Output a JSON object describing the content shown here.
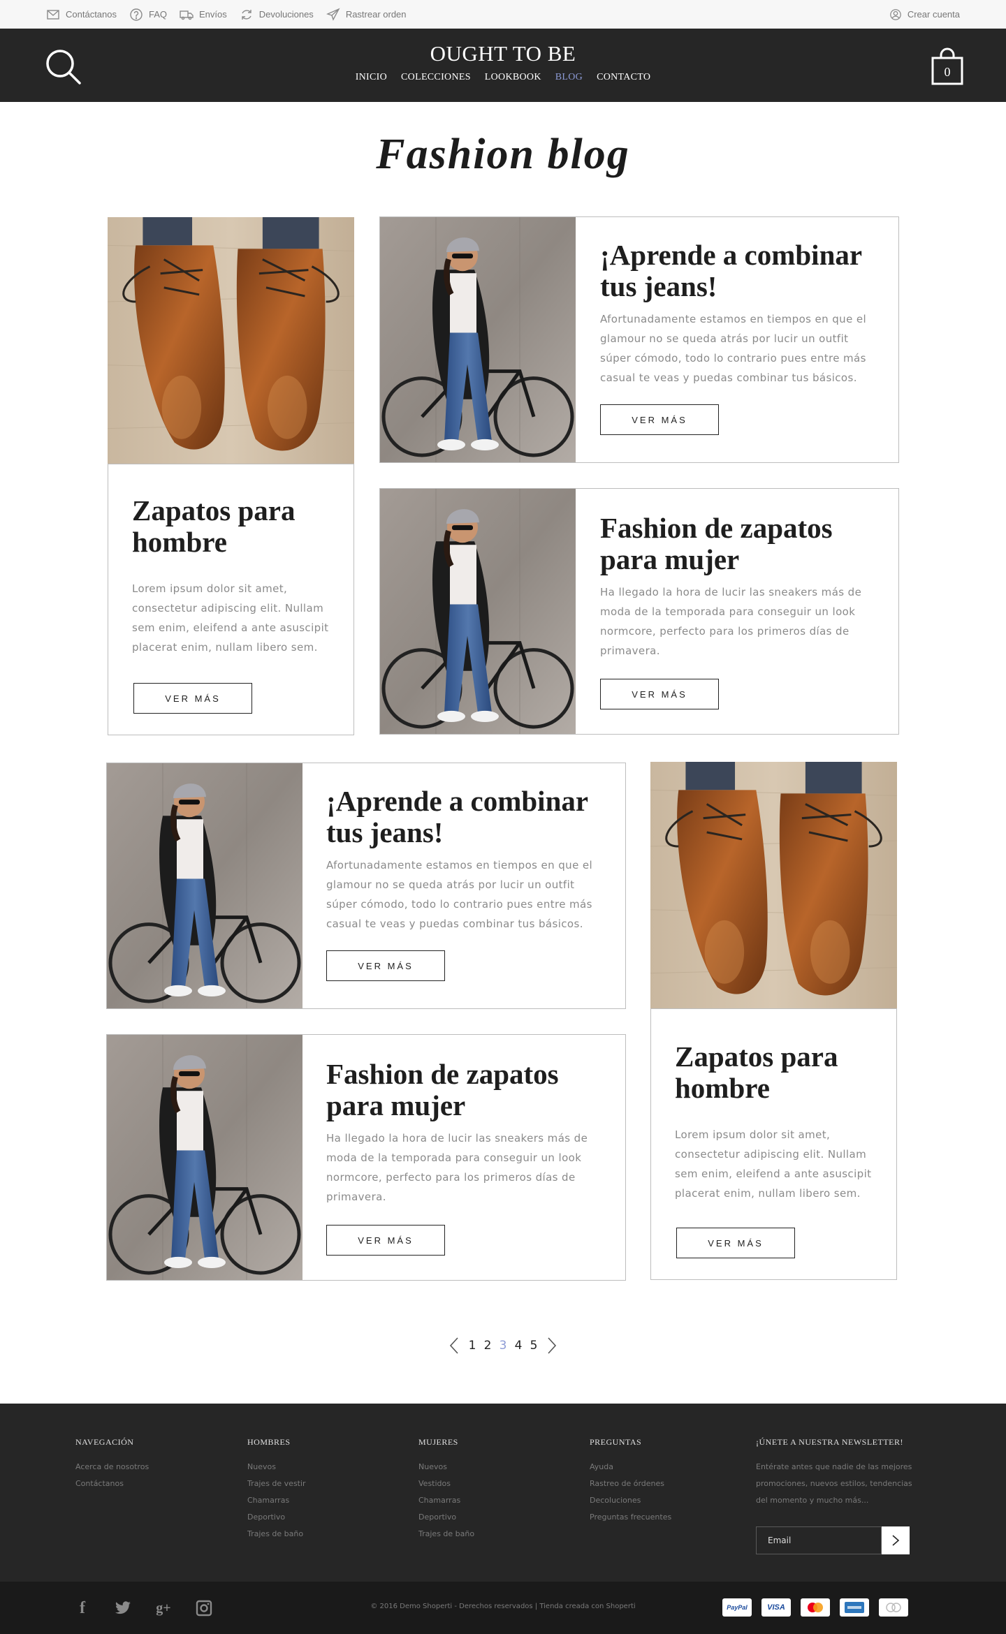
{
  "topbar": {
    "links": [
      {
        "label": "Contáctanos",
        "icon": "mail-icon"
      },
      {
        "label": "FAQ",
        "icon": "question-icon"
      },
      {
        "label": "Envíos",
        "icon": "truck-icon"
      },
      {
        "label": "Devoluciones",
        "icon": "refresh-icon"
      },
      {
        "label": "Rastrear orden",
        "icon": "send-icon"
      }
    ],
    "account_label": "Crear cuenta"
  },
  "header": {
    "brand": "OUGHT TO BE",
    "nav": [
      "INICIO",
      "COLECCIONES",
      "LOOKBOOK",
      "BLOG",
      "CONTACTO"
    ],
    "active_nav": "BLOG",
    "cart_count": "0",
    "accent_color": "#8d9bd6"
  },
  "page": {
    "title": "Fashion blog"
  },
  "posts": [
    {
      "title": "Zapatos para hombre",
      "excerpt": "Lorem ipsum dolor sit amet, consectetur adipiscing elit. Nullam sem enim, eleifend a ante asuscipit placerat enim, nullam libero sem.",
      "button": "VER MÁS",
      "image": "brown-shoes"
    },
    {
      "title": "¡Aprende a combinar tus jeans!",
      "excerpt": "Afortunadamente estamos en tiempos en que el glamour no se queda atrás por lucir un outfit súper cómodo, todo lo contrario pues entre más casual te veas y puedas combinar tus básicos.",
      "button": "VER MÁS",
      "image": "woman-bicycle"
    },
    {
      "title": "Fashion de zapatos para mujer",
      "excerpt": "Ha llegado la hora de lucir las sneakers más de moda de la temporada para conseguir un look normcore, perfecto para los primeros días de primavera.",
      "button": "VER MÁS",
      "image": "woman-bicycle"
    },
    {
      "title": "¡Aprende a combinar tus jeans!",
      "excerpt": "Afortunadamente estamos en tiempos en que el glamour no se queda atrás por lucir un outfit súper cómodo, todo lo contrario pues entre más casual te veas y puedas combinar tus básicos.",
      "button": "VER MÁS",
      "image": "woman-bicycle"
    },
    {
      "title": "Zapatos para hombre",
      "excerpt": "Lorem ipsum dolor sit amet, consectetur adipiscing elit. Nullam sem enim, eleifend a ante asuscipit placerat enim, nullam libero sem.",
      "button": "VER MÁS",
      "image": "brown-shoes"
    },
    {
      "title": "Fashion de zapatos para mujer",
      "excerpt": "Ha llegado la hora de lucir las sneakers más de moda de la temporada para conseguir un look normcore, perfecto para los primeros días de primavera.",
      "button": "VER MÁS",
      "image": "woman-bicycle"
    }
  ],
  "pagination": {
    "pages": [
      "1",
      "2",
      "3",
      "4",
      "5"
    ],
    "current": "3"
  },
  "footer": {
    "columns": [
      {
        "heading": "NAVEGACIÓN",
        "links": [
          "Acerca de nosotros",
          "Contáctanos"
        ]
      },
      {
        "heading": "HOMBRES",
        "links": [
          "Nuevos",
          "Trajes de vestir",
          "Chamarras",
          "Deportivo",
          "Trajes de baño"
        ]
      },
      {
        "heading": "MUJERES",
        "links": [
          "Nuevos",
          "Vestidos",
          "Chamarras",
          "Deportivo",
          "Trajes de baño"
        ]
      },
      {
        "heading": "PREGUNTAS",
        "links": [
          "Ayuda",
          "Rastreo de órdenes",
          "Decoluciones",
          "Preguntas frecuentes"
        ]
      }
    ],
    "newsletter": {
      "heading": "¡ÚNETE A NUESTRA NEWSLETTER!",
      "description": "Entérate antes que nadie de las mejores promociones, nuevos estilos, tendencias del momento y mucho más...",
      "placeholder": "Email"
    },
    "social": [
      "facebook-icon",
      "twitter-icon",
      "google-plus-icon",
      "instagram-icon"
    ],
    "copyright": "© 2016 Demo Shoperti - Derechos reservados | Tienda creada con Shoperti",
    "payments": [
      "PayPal",
      "VISA",
      "mastercard",
      "american-express",
      "oxxo"
    ]
  }
}
